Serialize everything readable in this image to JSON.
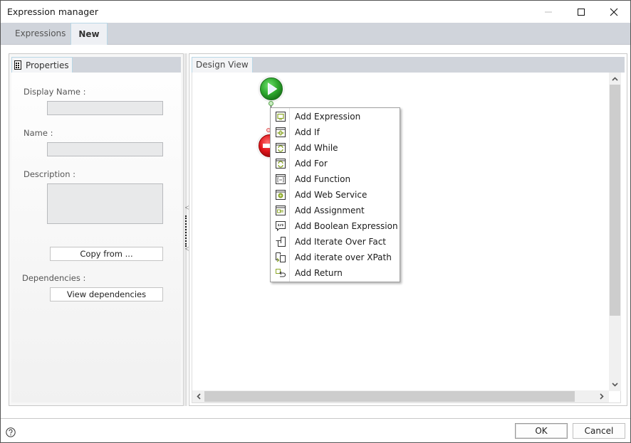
{
  "window": {
    "title": "Expression manager",
    "controls": {
      "minimize": "minimize-icon",
      "maximize": "maximize-icon",
      "close": "close-icon"
    }
  },
  "tabs": [
    {
      "label": "Expressions",
      "active": false
    },
    {
      "label": "New",
      "active": true
    }
  ],
  "properties": {
    "header": "Properties",
    "header_icon": "properties-grid-icon",
    "display_name_label": "Display Name :",
    "display_name_value": "",
    "name_label": "Name :",
    "name_value": "",
    "description_label": "Description :",
    "description_value": "",
    "copy_from_button": "Copy from ...",
    "dependencies_label": "Dependencies :",
    "view_dependencies_button": "View dependencies"
  },
  "design_view": {
    "header": "Design View",
    "nodes": [
      {
        "type": "start",
        "icon": "play-icon",
        "color": "#2ea82e"
      },
      {
        "type": "end",
        "icon": "stop-icon",
        "color": "#e0141a"
      }
    ]
  },
  "context_menu": {
    "items": [
      {
        "label": "Add Expression",
        "icon": "expression-icon"
      },
      {
        "label": "Add If",
        "icon": "if-icon"
      },
      {
        "label": "Add While",
        "icon": "while-icon"
      },
      {
        "label": "Add For",
        "icon": "for-icon"
      },
      {
        "label": "Add Function",
        "icon": "function-icon"
      },
      {
        "label": "Add Web Service",
        "icon": "web-service-icon"
      },
      {
        "label": "Add Assignment",
        "icon": "assignment-icon"
      },
      {
        "label": "Add Boolean Expression",
        "icon": "boolean-expression-icon"
      },
      {
        "label": "Add Iterate Over Fact",
        "icon": "iterate-fact-icon"
      },
      {
        "label": "Add iterate over XPath",
        "icon": "iterate-xpath-icon"
      },
      {
        "label": "Add Return",
        "icon": "return-icon"
      }
    ]
  },
  "footer": {
    "help_icon": "help-icon",
    "ok_button": "OK",
    "cancel_button": "Cancel"
  },
  "colors": {
    "accent_green": "#8aa626",
    "tab_bar": "#d0d4db",
    "tab_border": "#b9d7e6"
  }
}
